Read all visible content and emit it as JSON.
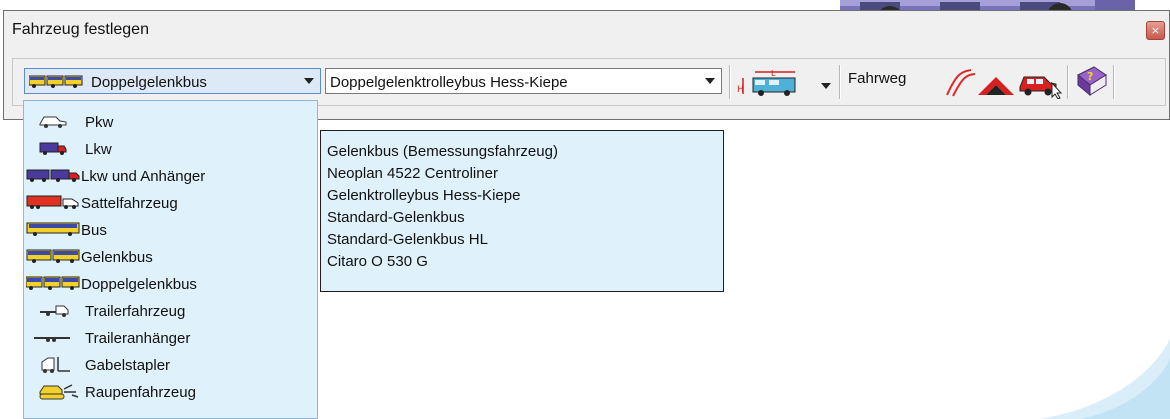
{
  "window": {
    "title": "Fahrzeug festlegen",
    "close_glyph": "×"
  },
  "toolbar": {
    "category_combo": {
      "value": "Doppelgelenkbus",
      "icon": "articulated-bus-icon"
    },
    "vehicle_combo": {
      "value": "Doppelgelenktrolleybus Hess-Kiepe"
    },
    "dimension_button": {
      "icon": "vehicle-dimension-icon"
    },
    "fahrweg_label": "Fahrweg",
    "buttons": [
      {
        "icon": "path-curve-icon"
      },
      {
        "icon": "ramp-icon"
      },
      {
        "icon": "car-cursor-icon"
      },
      {
        "icon": "help-book-icon"
      }
    ]
  },
  "category_dropdown": {
    "items": [
      {
        "label": "Pkw",
        "icon": "car-icon"
      },
      {
        "label": "Lkw",
        "icon": "truck-icon"
      },
      {
        "label": "Lkw und Anhänger",
        "icon": "truck-trailer-icon"
      },
      {
        "label": "Sattelfahrzeug",
        "icon": "semi-truck-icon"
      },
      {
        "label": "Bus",
        "icon": "bus-icon"
      },
      {
        "label": "Gelenkbus",
        "icon": "articulated-bus-icon"
      },
      {
        "label": "Doppelgelenkbus",
        "icon": "double-articulated-bus-icon"
      },
      {
        "label": "Trailerfahrzeug",
        "icon": "trailer-vehicle-icon"
      },
      {
        "label": "Traileranhänger",
        "icon": "trailer-icon"
      },
      {
        "label": "Gabelstapler",
        "icon": "forklift-icon"
      },
      {
        "label": "Raupenfahrzeug",
        "icon": "tracked-vehicle-icon"
      }
    ]
  },
  "vehicle_list": {
    "items": [
      "Gelenkbus (Bemessungsfahrzeug)",
      "Neoplan 4522 Centroliner",
      "Gelenktrolleybus Hess-Kiepe",
      "Standard-Gelenkbus",
      "Standard-Gelenkbus HL",
      "Citaro O 530 G"
    ]
  },
  "colors": {
    "dropdown_bg": "#dff1fa",
    "selected_combo_bg": "#dde9f6",
    "bus_yellow": "#f2d22a",
    "bus_blue": "#3d4aa8",
    "truck_purple": "#4a3a9c",
    "semi_red": "#e03222"
  }
}
